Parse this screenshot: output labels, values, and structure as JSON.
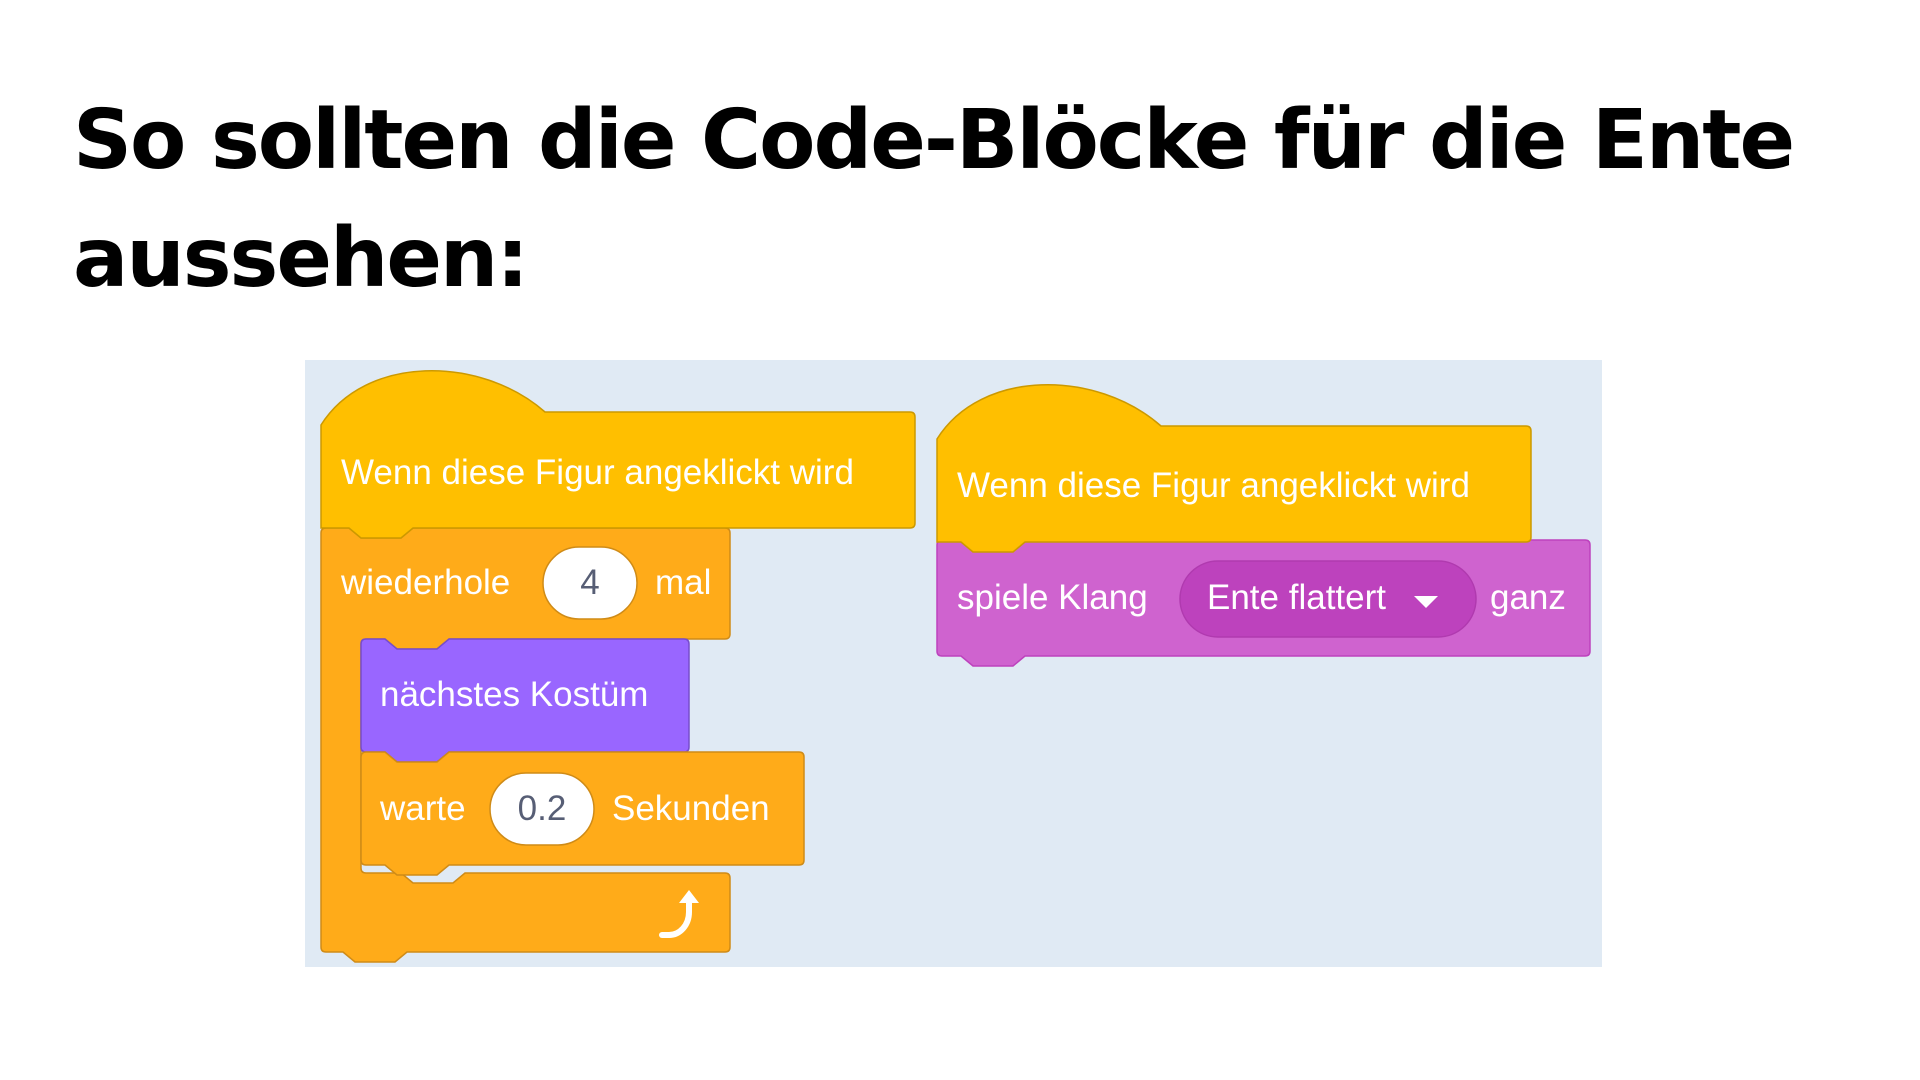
{
  "heading": "So sollten die Code-Blöcke für die Ente aussehen:",
  "colors": {
    "workspace_bg": "#e0eaf4",
    "events": "#ffbf00",
    "events_border": "#cc9900",
    "control": "#ffab19",
    "control_border": "#cf8b17",
    "looks": "#9966ff",
    "looks_border": "#774dcb",
    "sound": "#cf63cf",
    "sound_border": "#bd42bd",
    "sound_dropdown": "#bd42bd"
  },
  "script_left": {
    "hat_label": "Wenn diese Figur angeklickt wird",
    "repeat": {
      "label_before": "wiederhole",
      "count": "4",
      "label_after": "mal",
      "loop_icon": "loop-arrow-icon"
    },
    "next_costume_label": "nächstes Kostüm",
    "wait": {
      "label_before": "warte",
      "seconds": "0.2",
      "label_after": "Sekunden"
    }
  },
  "script_right": {
    "hat_label": "Wenn diese Figur angeklickt wird",
    "play_sound": {
      "label_before": "spiele Klang",
      "sound": "Ente flattert",
      "label_after": "ganz",
      "dropdown_icon": "caret-down-icon"
    }
  }
}
